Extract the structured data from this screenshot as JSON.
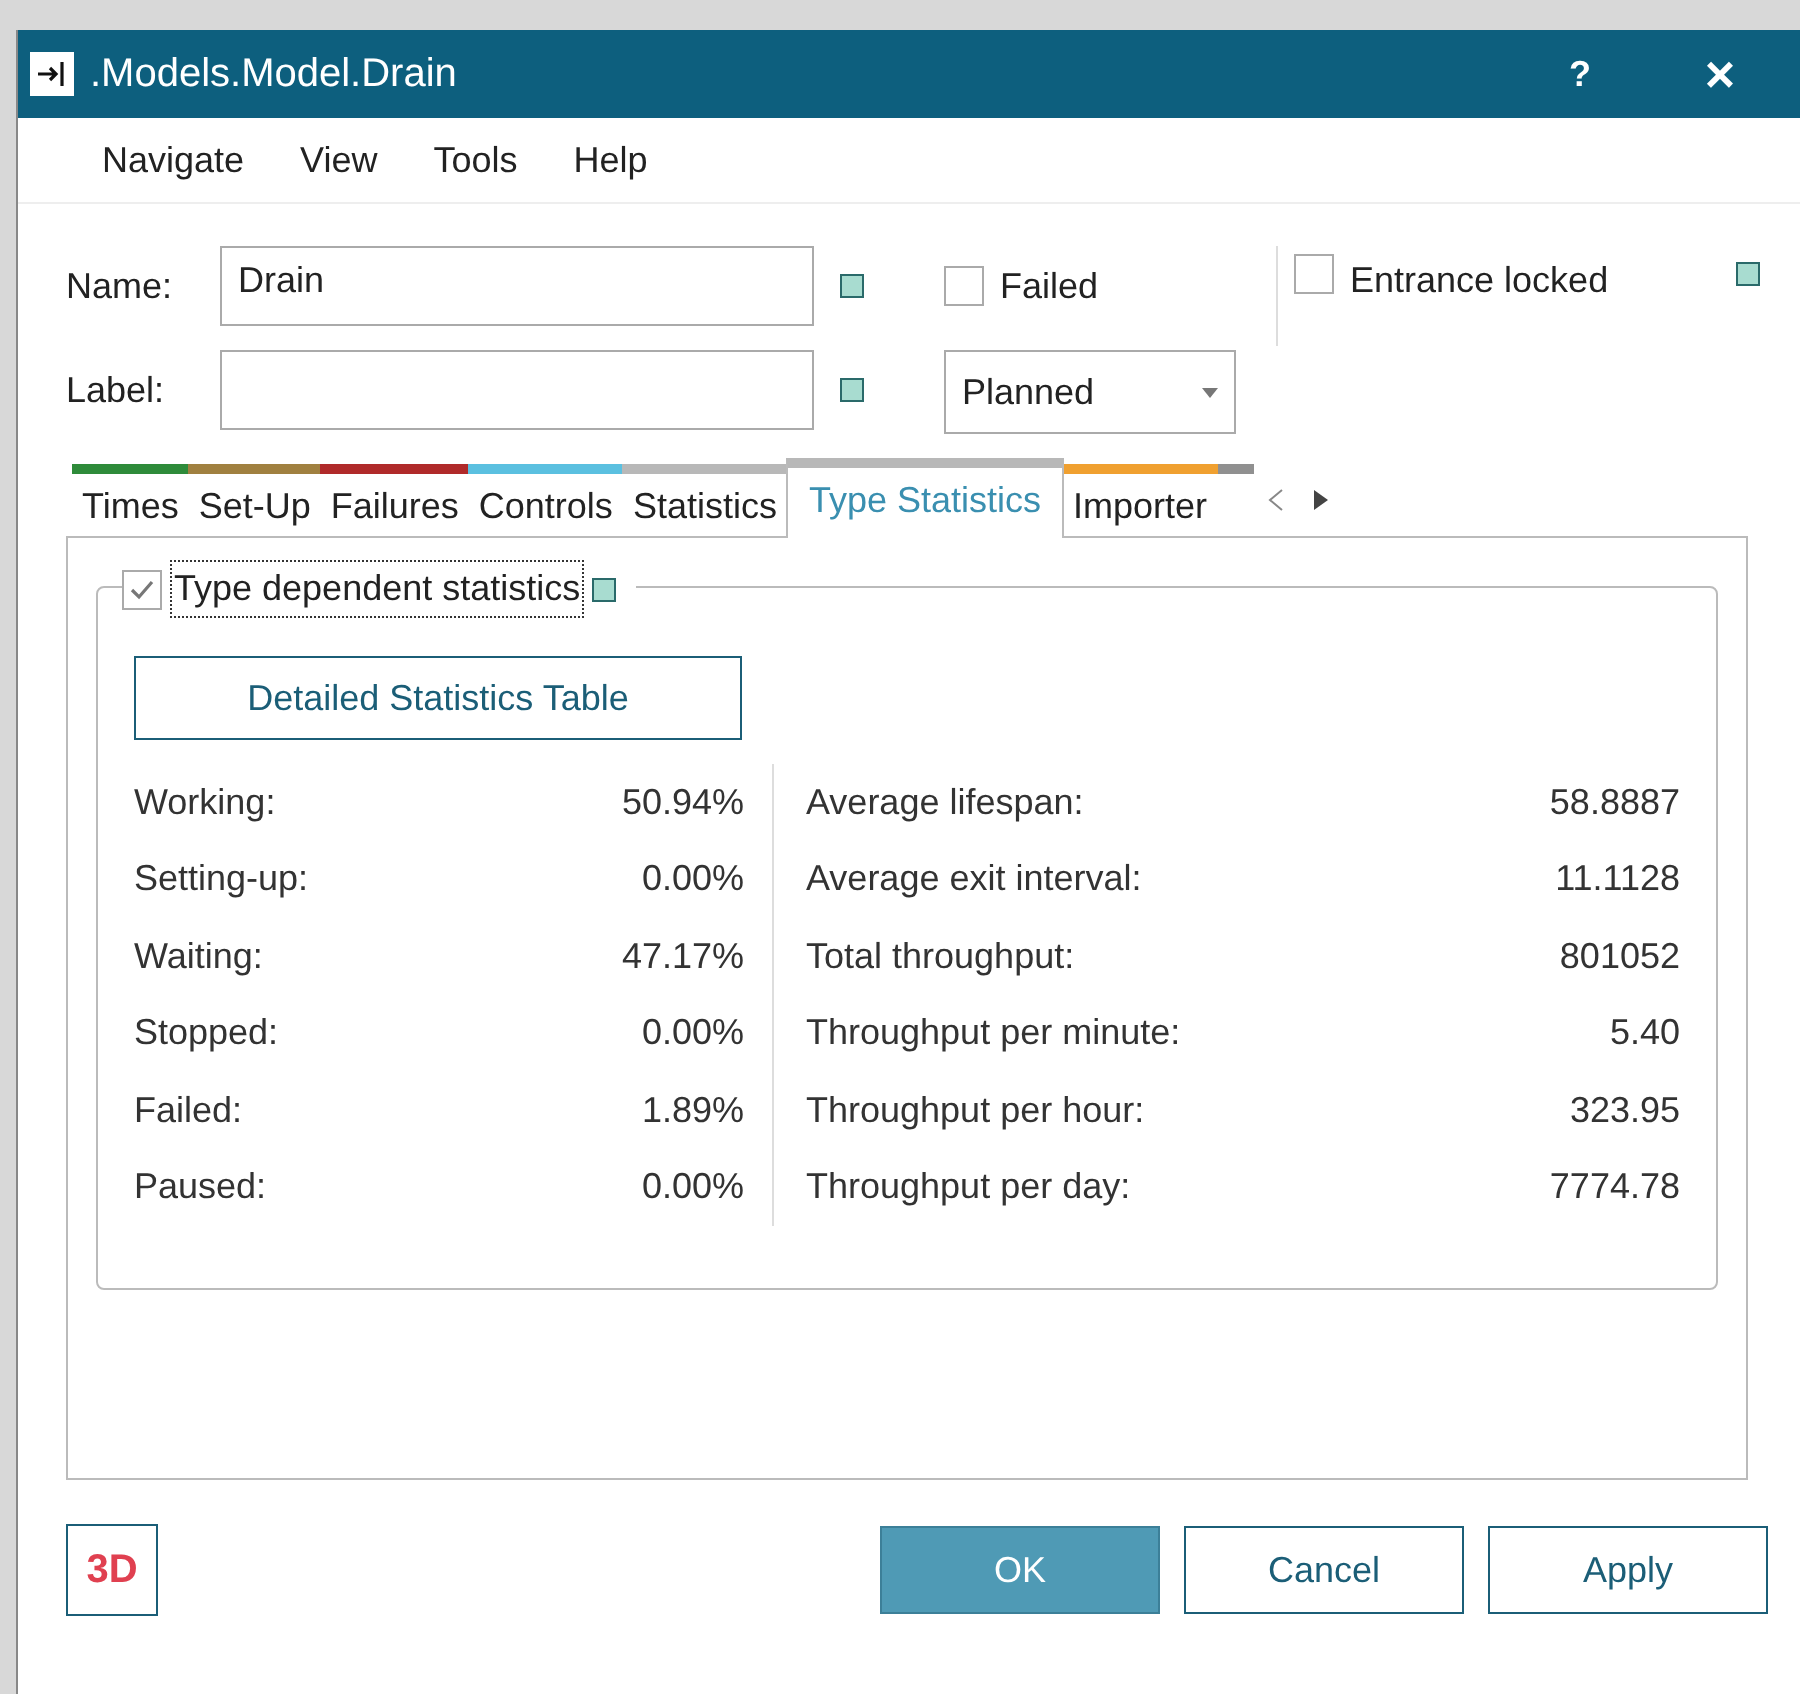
{
  "window": {
    "title": ".Models.Model.Drain"
  },
  "title_buttons": [
    "?",
    "×"
  ],
  "menu": [
    "Navigate",
    "View",
    "Tools",
    "Help"
  ],
  "name": {
    "label": "Name:",
    "value": "Drain"
  },
  "label_field": {
    "label": "Label:"
  },
  "failed": {
    "label": "Failed",
    "checked": false
  },
  "entrance_locked": {
    "label": "Entrance locked",
    "checked": false
  },
  "planned": {
    "value": "Planned"
  },
  "tabs": [
    {
      "label": "Times",
      "color": "#2e8b3a",
      "selected": false
    },
    {
      "label": "Set-Up",
      "color": "#a08040",
      "selected": false
    },
    {
      "label": "Failures",
      "color": "#b02a2a",
      "selected": false
    },
    {
      "label": "Controls",
      "color": "#5bc0e0",
      "selected": false
    },
    {
      "label": "Statistics",
      "color": "#b8b8b8",
      "selected": false
    },
    {
      "label": "Type Statistics",
      "color": "#b8b8b8",
      "selected": true
    },
    {
      "label": "Importer",
      "color": "#f0a030",
      "selected": false
    },
    {
      "color": "#909090",
      "selected": false
    }
  ],
  "group": {
    "label": "Type dependent statistics",
    "checked": true
  },
  "detail_button": "Detailed Statistics Table",
  "left_stats": [
    {
      "label": "Working:",
      "value": "50.94%"
    },
    {
      "label": "Setting-up:",
      "value": "0.00%"
    },
    {
      "label": "Waiting:",
      "value": "47.17%"
    },
    {
      "label": "Stopped:",
      "value": "0.00%"
    },
    {
      "label": "Failed:",
      "value": "1.89%"
    },
    {
      "label": "Paused:",
      "value": "0.00%"
    }
  ],
  "right_stats": [
    {
      "label": "Average lifespan:",
      "value": "58.8887"
    },
    {
      "label": "Average exit interval:",
      "value": "11.1128"
    },
    {
      "label": "Total throughput:",
      "value": "801052"
    },
    {
      "label": "Throughput per minute:",
      "value": "5.40"
    },
    {
      "label": "Throughput per hour:",
      "value": "323.95"
    },
    {
      "label": "Throughput per day:",
      "value": "7774.78"
    }
  ],
  "badge": "3D",
  "buttons": [
    {
      "label": "OK",
      "kind": "primary"
    },
    {
      "label": "Cancel",
      "kind": "normal"
    },
    {
      "label": "Apply",
      "kind": "normal"
    }
  ]
}
